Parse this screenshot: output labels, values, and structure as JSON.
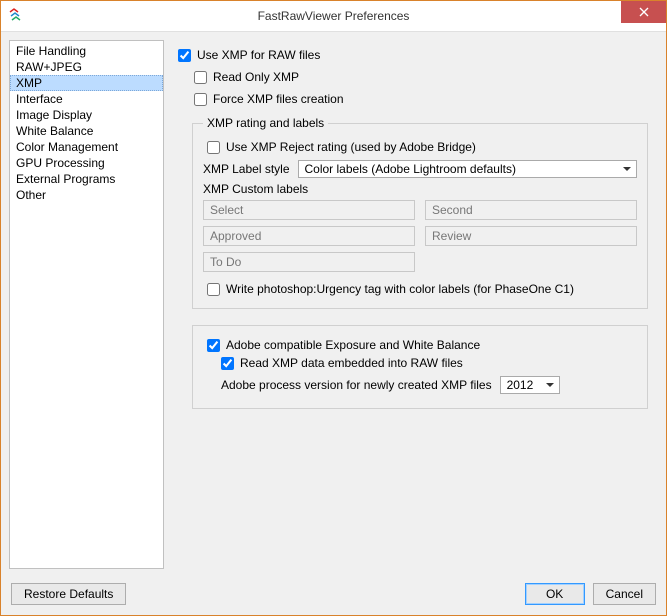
{
  "window": {
    "title": "FastRawViewer Preferences"
  },
  "sidebar": {
    "items": [
      {
        "label": "File Handling",
        "selected": false
      },
      {
        "label": "RAW+JPEG",
        "selected": false
      },
      {
        "label": "XMP",
        "selected": true
      },
      {
        "label": "Interface",
        "selected": false
      },
      {
        "label": "Image Display",
        "selected": false
      },
      {
        "label": "White Balance",
        "selected": false
      },
      {
        "label": "Color Management",
        "selected": false
      },
      {
        "label": "GPU Processing",
        "selected": false
      },
      {
        "label": "External Programs",
        "selected": false
      },
      {
        "label": "Other",
        "selected": false
      }
    ]
  },
  "xmp": {
    "use_xmp_label": "Use XMP for RAW files",
    "use_xmp_checked": true,
    "read_only_label": "Read Only XMP",
    "read_only_checked": false,
    "force_creation_label": "Force XMP files creation",
    "force_creation_checked": false,
    "rating_labels": {
      "legend": "XMP rating and labels",
      "use_reject_label": "Use XMP Reject rating (used by Adobe Bridge)",
      "use_reject_checked": false,
      "label_style_label": "XMP Label style",
      "label_style_value": "Color labels (Adobe Lightroom defaults)",
      "custom_labels_heading": "XMP Custom labels",
      "custom_labels": [
        "Select",
        "Second",
        "Approved",
        "Review",
        "To Do"
      ],
      "write_urgency_label": "Write photoshop:Urgency tag with color labels (for PhaseOne C1)",
      "write_urgency_checked": false
    },
    "adobe_section": {
      "adobe_compat_label": "Adobe compatible Exposure and White Balance",
      "adobe_compat_checked": true,
      "read_embedded_label": "Read XMP data embedded into RAW files",
      "read_embedded_checked": true,
      "process_version_label": "Adobe process version for newly created XMP files",
      "process_version_value": "2012"
    }
  },
  "footer": {
    "restore_label": "Restore Defaults",
    "ok_label": "OK",
    "cancel_label": "Cancel"
  }
}
